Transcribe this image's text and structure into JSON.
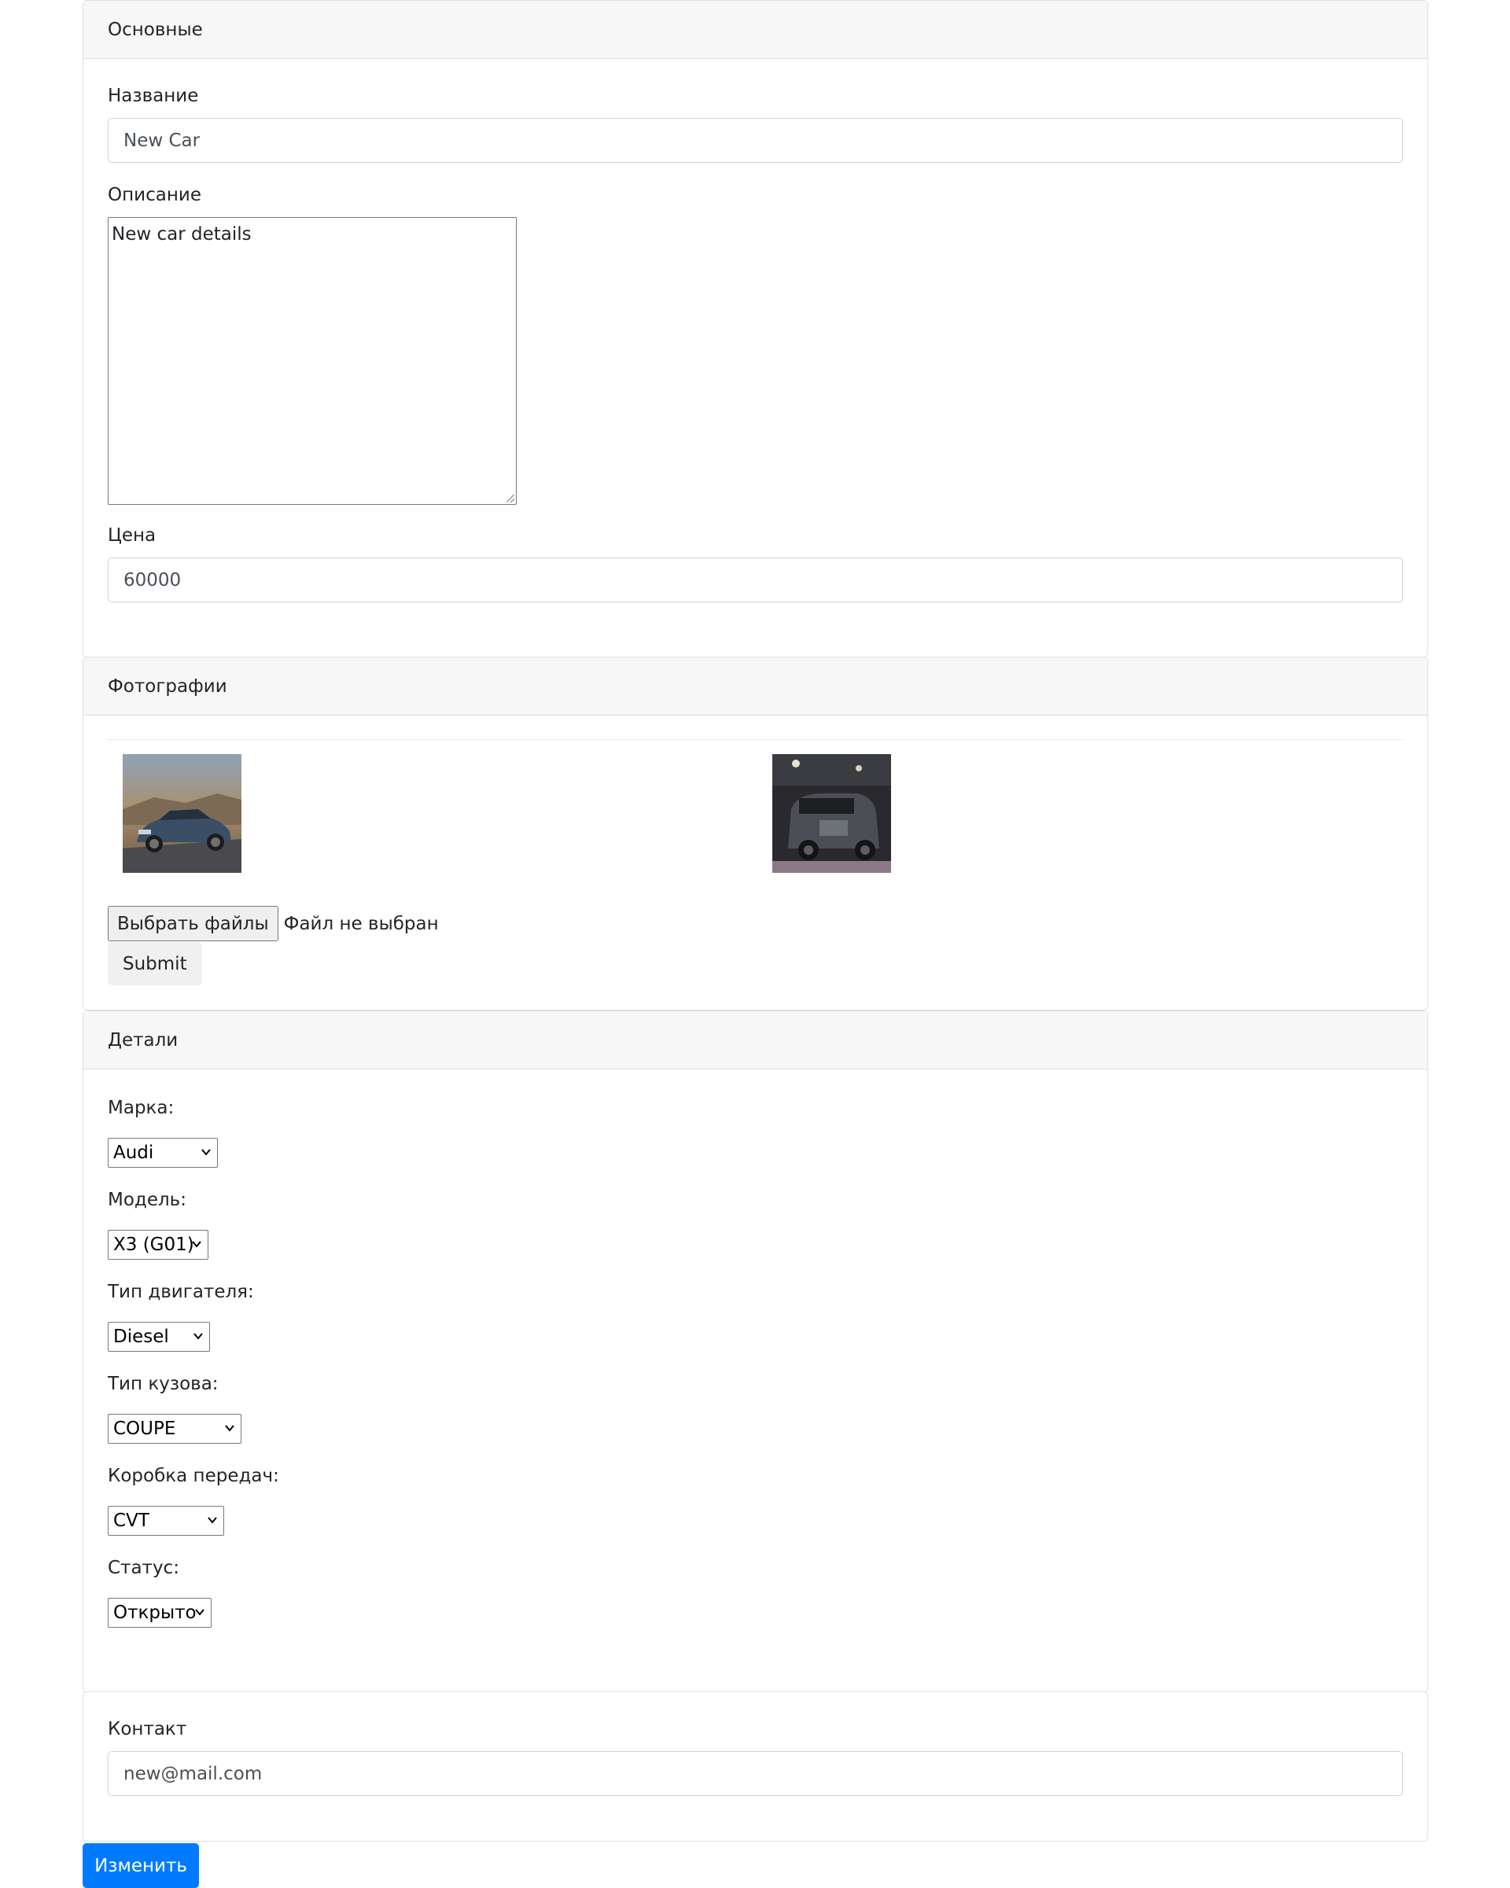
{
  "basic": {
    "header": "Основные",
    "name_label": "Название",
    "name_value": "New Car",
    "description_label": "Описание",
    "description_value": "New car details",
    "price_label": "Цена",
    "price_value": "60000"
  },
  "photos": {
    "header": "Фотографии",
    "choose_files_label": "Выбрать файлы",
    "no_file_text": "Файл не выбран",
    "submit_label": "Submit"
  },
  "details": {
    "header": "Детали",
    "brand_label": "Марка:",
    "brand_value": "Audi",
    "model_label": "Модель:",
    "model_value": "X3 (G01)",
    "engine_label": "Тип двигателя:",
    "engine_value": "Diesel",
    "body_label": "Тип кузова:",
    "body_value": "COUPE",
    "gearbox_label": "Коробка передач:",
    "gearbox_value": "CVT",
    "status_label": "Статус:",
    "status_value": "Открыто"
  },
  "contact": {
    "label": "Контакт",
    "value": "new@mail.com"
  },
  "actions": {
    "save_label": "Изменить"
  }
}
